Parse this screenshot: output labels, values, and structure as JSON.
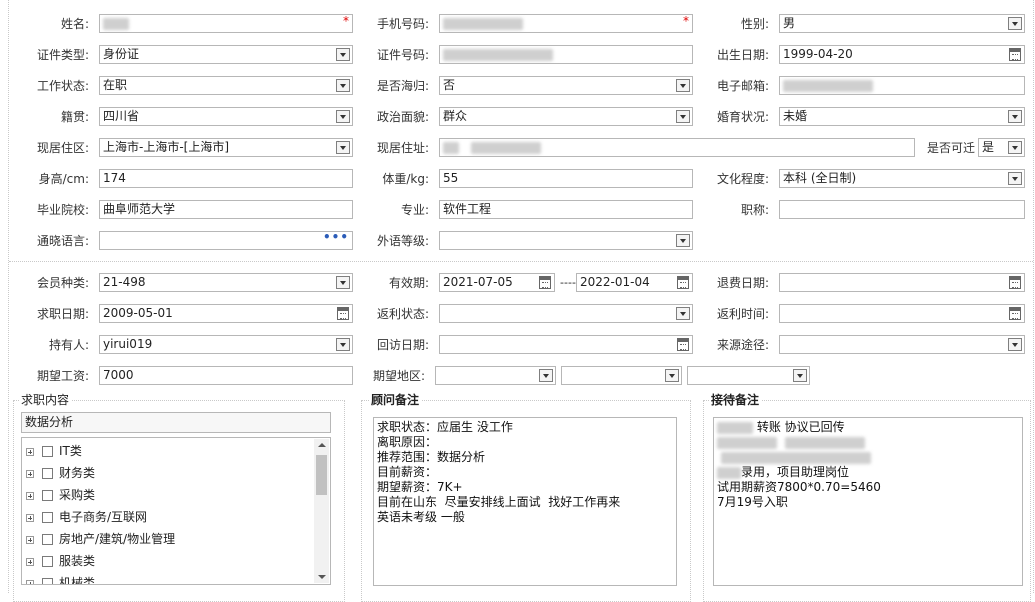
{
  "personal": {
    "name": {
      "label": "姓名:",
      "required": "*"
    },
    "phone": {
      "label": "手机号码:",
      "required": "*"
    },
    "gender": {
      "label": "性别:",
      "value": "男"
    },
    "id_type": {
      "label": "证件类型:",
      "value": "身份证"
    },
    "id_number": {
      "label": "证件号码:"
    },
    "birth": {
      "label": "出生日期:",
      "value": "1999-04-20"
    },
    "work_status": {
      "label": "工作状态:",
      "value": "在职"
    },
    "returnee": {
      "label": "是否海归:",
      "value": "否"
    },
    "email": {
      "label": "电子邮箱:"
    },
    "native": {
      "label": "籍贯:",
      "value": "四川省"
    },
    "political": {
      "label": "政治面貌:",
      "value": "群众"
    },
    "marital": {
      "label": "婚育状况:",
      "value": "未婚"
    },
    "residence_area": {
      "label": "现居住区:",
      "value": "上海市-上海市-[上海市]"
    },
    "residence_addr": {
      "label": "现居住址:"
    },
    "relocate": {
      "label": "是否可迁",
      "value": "是"
    },
    "height": {
      "label": "身高/cm:",
      "value": "174"
    },
    "weight": {
      "label": "体重/kg:",
      "value": "55"
    },
    "education": {
      "label": "文化程度:",
      "value": "本科 (全日制)"
    },
    "school": {
      "label": "毕业院校:",
      "value": "曲阜师范大学"
    },
    "major": {
      "label": "专业:",
      "value": "软件工程"
    },
    "title": {
      "label": "职称:",
      "value": ""
    },
    "language": {
      "label": "通晓语言:",
      "value": "",
      "more": "•••"
    },
    "foreign_level": {
      "label": "外语等级:",
      "value": ""
    }
  },
  "membership": {
    "member_type": {
      "label": "会员种类:",
      "value": "21-498"
    },
    "valid": {
      "label": "有效期:",
      "from": "2021-07-05",
      "sep": "----",
      "to": "2022-01-04"
    },
    "refund_date": {
      "label": "退费日期:",
      "value": ""
    },
    "job_date": {
      "label": "求职日期:",
      "value": "2009-05-01"
    },
    "rebate_status": {
      "label": "返利状态:",
      "value": ""
    },
    "rebate_time": {
      "label": "返利时间:",
      "value": ""
    },
    "holder": {
      "label": "持有人:",
      "value": "yirui019"
    },
    "visit_date": {
      "label": "回访日期:",
      "value": ""
    },
    "source": {
      "label": "来源途径:",
      "value": ""
    },
    "salary": {
      "label": "期望工资:",
      "value": "7000"
    },
    "region": {
      "label": "期望地区:"
    }
  },
  "job_content": {
    "title": "求职内容",
    "search_value": "数据分析",
    "items": [
      "IT类",
      "财务类",
      "采购类",
      "电子商务/互联网",
      "房地产/建筑/物业管理",
      "服装类",
      "机械类"
    ]
  },
  "consultant": {
    "title": "顾问备注",
    "text": "求职状态：应届生 没工作\n离职原因：\n推荐范围：数据分析\n目前薪资：\n期望薪资：7K+\n目前在山东  尽量安排线上面试  找好工作再来\n英语未考级 一般"
  },
  "reception": {
    "title": "接待备注",
    "line1": "转账 协议已回传",
    "line3": "录用，项目助理岗位",
    "line4": "试用期薪资7800*0.70=5460",
    "line5": "7月19号入职"
  }
}
